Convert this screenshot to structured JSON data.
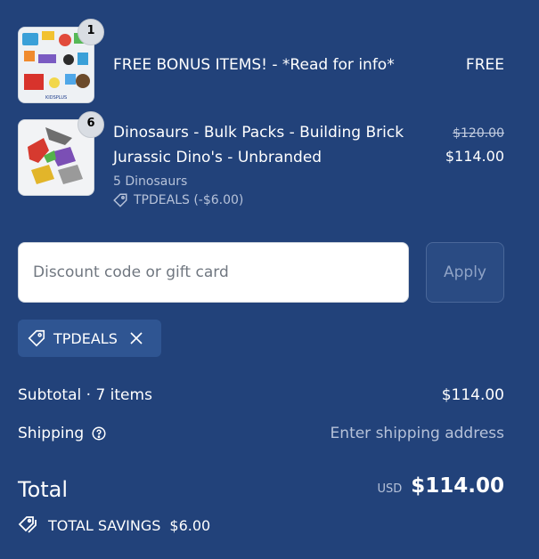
{
  "items": [
    {
      "quantity": "1",
      "title": "FREE BONUS ITEMS! - *Read for info*",
      "price": "FREE",
      "thumb_caption": "KIDSPLUS"
    },
    {
      "quantity": "6",
      "title_line1": "Dinosaurs - Bulk Packs - Building Brick",
      "title_line2": "Jurassic Dino's - Unbranded",
      "variant": "5 Dinosaurs",
      "discount_tag": "TPDEALS (-$6.00)",
      "original_price": "$120.00",
      "price": "$114.00"
    }
  ],
  "discount": {
    "placeholder": "Discount code or gift card",
    "apply_label": "Apply",
    "applied_code": "TPDEALS"
  },
  "summary": {
    "subtotal_label": "Subtotal · 7 items",
    "subtotal_value": "$114.00",
    "shipping_label": "Shipping",
    "shipping_value": "Enter shipping address",
    "total_label": "Total",
    "currency": "USD",
    "total_value": "$114.00",
    "savings_label": "TOTAL SAVINGS",
    "savings_value": "$6.00"
  },
  "colors": {
    "background": "#22427a",
    "chip": "#2f5592",
    "muted_text": "#b6c2d9"
  }
}
